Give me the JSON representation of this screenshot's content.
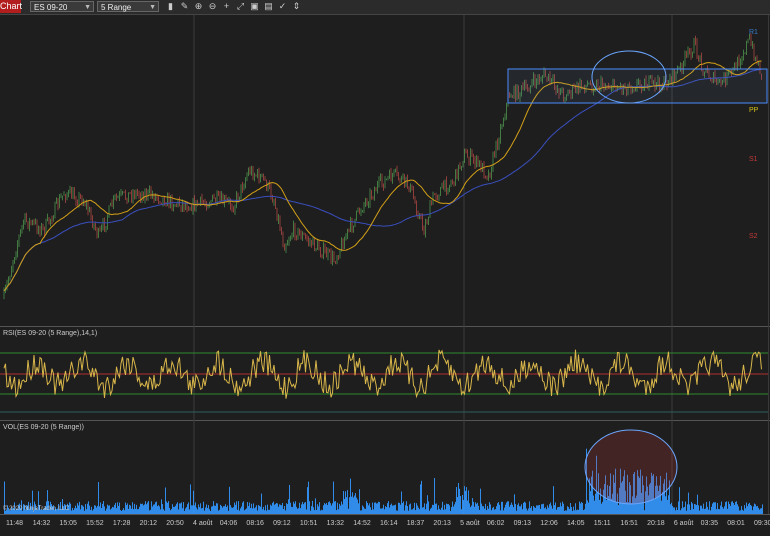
{
  "toolbar": {
    "chart_label": "Chart",
    "instrument": "ES 09-20",
    "interval": "5 Range",
    "icons": [
      "bars-icon",
      "pencil-icon",
      "zoom-in-icon",
      "zoom-out-icon",
      "crosshair-icon",
      "move-icon",
      "strategy-icon",
      "template-icon",
      "properties-icon",
      "scale-icon"
    ]
  },
  "price_panel": {
    "pivot_labels": [
      {
        "text": "R1",
        "color": "#3a7dc9"
      },
      {
        "text": "PP",
        "color": "#d6c21a"
      },
      {
        "text": "S1",
        "color": "#c43a3a"
      },
      {
        "text": "S2",
        "color": "#c43a3a"
      }
    ]
  },
  "rsi_panel": {
    "title": "RSI(ES 09-20 (5 Range),14,1)"
  },
  "vol_panel": {
    "title": "VOL(ES 09-20 (5 Range))",
    "copyright": "© 2020 NinjaTrader, LLC"
  },
  "x_axis": {
    "labels": [
      "11:48",
      "14:32",
      "15:05",
      "15:52",
      "17:28",
      "20:12",
      "20:50",
      "4 août",
      "04:06",
      "08:16",
      "09:12",
      "10:51",
      "13:32",
      "14:52",
      "16:14",
      "18:37",
      "20:13",
      "5 août",
      "06:02",
      "09:13",
      "12:06",
      "14:05",
      "15:11",
      "16:51",
      "20:18",
      "6 août",
      "03:35",
      "08:01",
      "09:30"
    ]
  },
  "colors": {
    "up_candle": "#5cb85c",
    "down_candle": "#d9534f",
    "rsi": "#d8b64a",
    "volume": "#3399ff",
    "ma_fast": "#d4a017",
    "ma_slow": "#3a4fbf",
    "green_line": "#2e8b2e",
    "red_line": "#b03030"
  }
}
